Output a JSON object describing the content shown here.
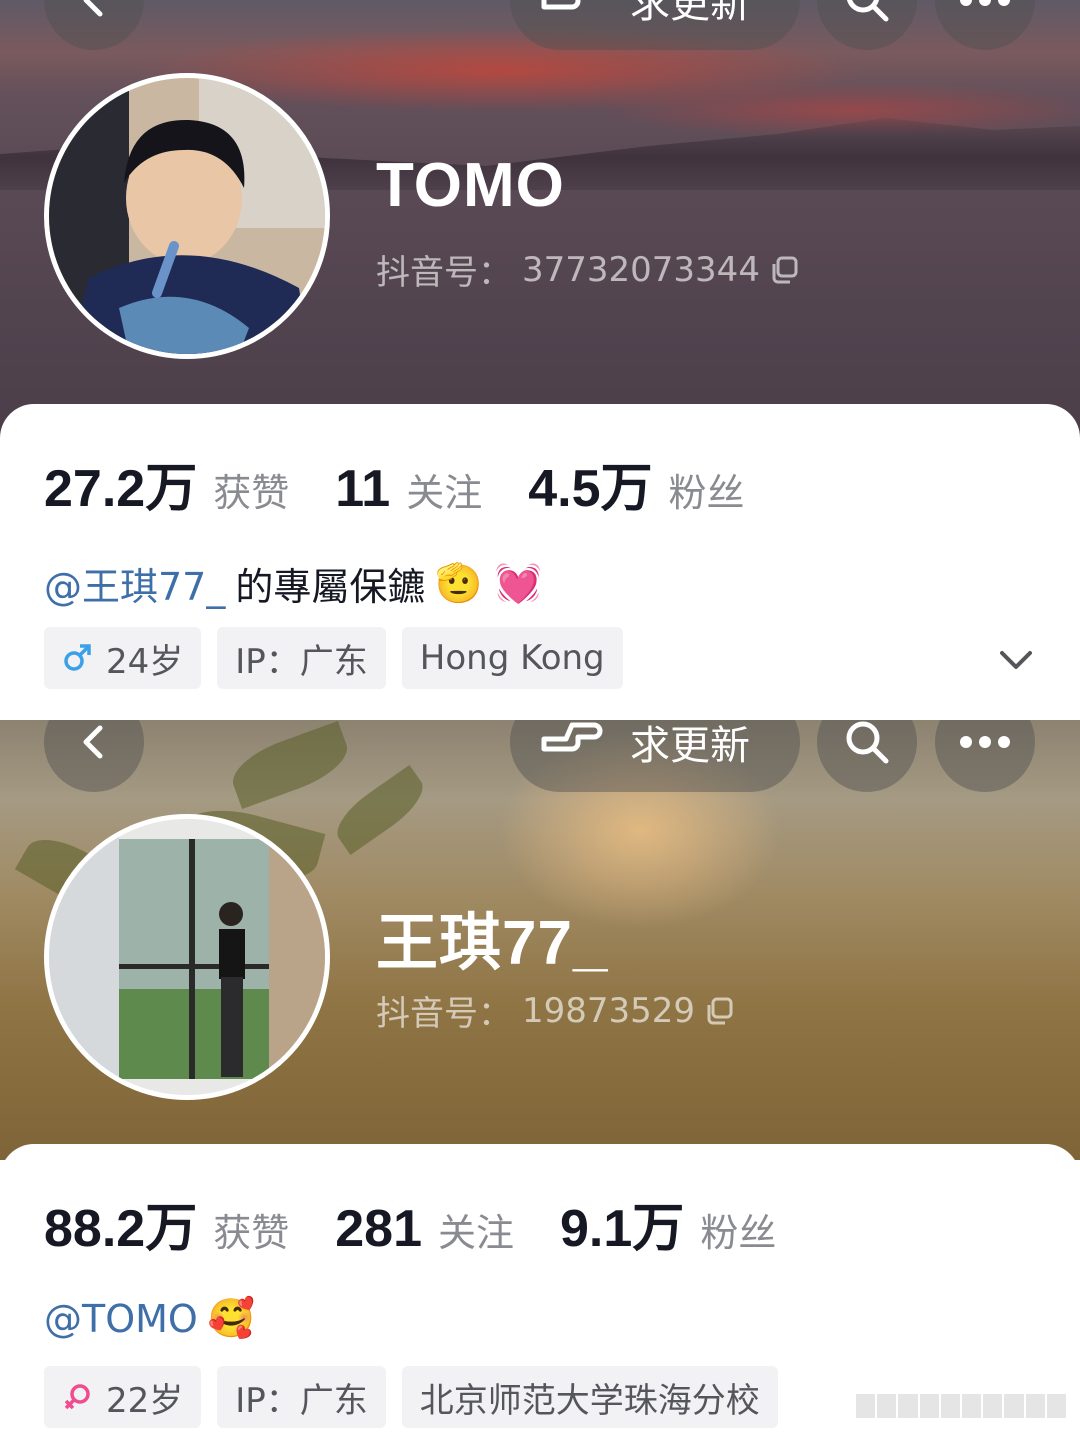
{
  "top_nav": {
    "request_update_label": "求更新",
    "icons": [
      "back-arrow-icon",
      "pointing-hand-icon",
      "search-icon",
      "more-dots-icon"
    ]
  },
  "profiles": [
    {
      "nickname": "TOMO",
      "douyin_id_label": "抖音号：",
      "douyin_id": "37732073344",
      "stats": [
        {
          "value": "27.2万",
          "label": "获赞"
        },
        {
          "value": "11",
          "label": "关注"
        },
        {
          "value": "4.5万",
          "label": "粉丝"
        }
      ],
      "bio": {
        "mention": "@王琪77_",
        "text": " 的專屬保鑣",
        "emojis": "🫡 💓"
      },
      "tags": {
        "gender_icon": "male-symbol-icon",
        "age": "24岁",
        "ip": "IP：广东",
        "location": "Hong Kong"
      },
      "gender_color": "#3aa0e8"
    },
    {
      "nickname": "王琪77_",
      "douyin_id_label": "抖音号：",
      "douyin_id": "19873529",
      "stats": [
        {
          "value": "88.2万",
          "label": "获赞"
        },
        {
          "value": "281",
          "label": "关注"
        },
        {
          "value": "9.1万",
          "label": "粉丝"
        }
      ],
      "bio": {
        "mention": "@TOMO",
        "text": "",
        "emojis": "🥰"
      },
      "tags": {
        "gender_icon": "female-symbol-icon",
        "age": "22岁",
        "ip": "IP：广东",
        "school": "北京师范大学珠海分校"
      },
      "gender_color": "#f04c8f"
    }
  ],
  "colors": {
    "stat_number": "#161823",
    "stat_label": "#8a8b91",
    "mention": "#3f6fa8",
    "tag_bg": "#f2f2f4"
  }
}
